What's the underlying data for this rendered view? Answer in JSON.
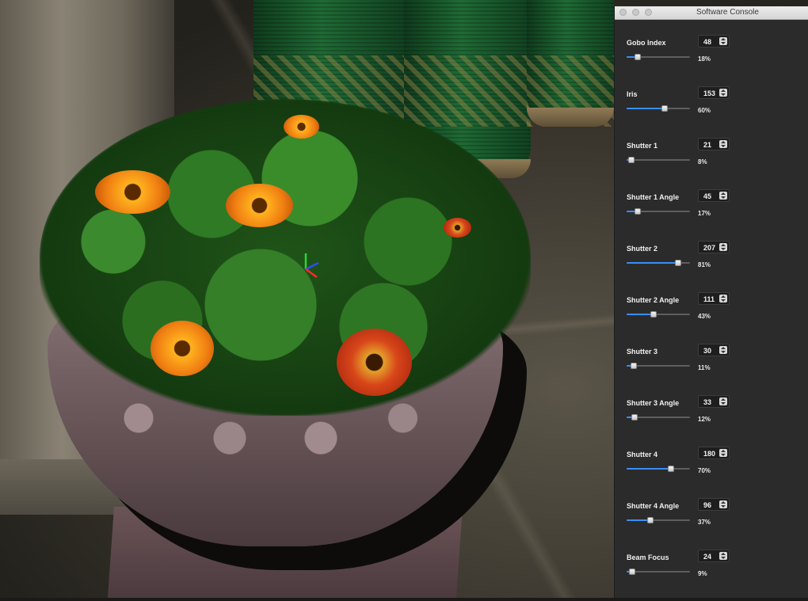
{
  "window": {
    "title": "Software Console"
  },
  "controls": [
    {
      "label": "Gobo Index",
      "value": "48",
      "percent": "18%",
      "fraction": 0.18
    },
    {
      "label": "Iris",
      "value": "153",
      "percent": "60%",
      "fraction": 0.6
    },
    {
      "label": "Shutter 1",
      "value": "21",
      "percent": "8%",
      "fraction": 0.08
    },
    {
      "label": "Shutter 1 Angle",
      "value": "45",
      "percent": "17%",
      "fraction": 0.17
    },
    {
      "label": "Shutter 2",
      "value": "207",
      "percent": "81%",
      "fraction": 0.81
    },
    {
      "label": "Shutter 2 Angle",
      "value": "111",
      "percent": "43%",
      "fraction": 0.43
    },
    {
      "label": "Shutter 3",
      "value": "30",
      "percent": "11%",
      "fraction": 0.11
    },
    {
      "label": "Shutter 3 Angle",
      "value": "33",
      "percent": "12%",
      "fraction": 0.12
    },
    {
      "label": "Shutter 4",
      "value": "180",
      "percent": "70%",
      "fraction": 0.7
    },
    {
      "label": "Shutter 4 Angle",
      "value": "96",
      "percent": "37%",
      "fraction": 0.37
    },
    {
      "label": "Beam Focus",
      "value": "24",
      "percent": "9%",
      "fraction": 0.09
    }
  ],
  "colors": {
    "slider_fill": "#3a8ef5",
    "panel_bg": "#2b2b2b"
  }
}
